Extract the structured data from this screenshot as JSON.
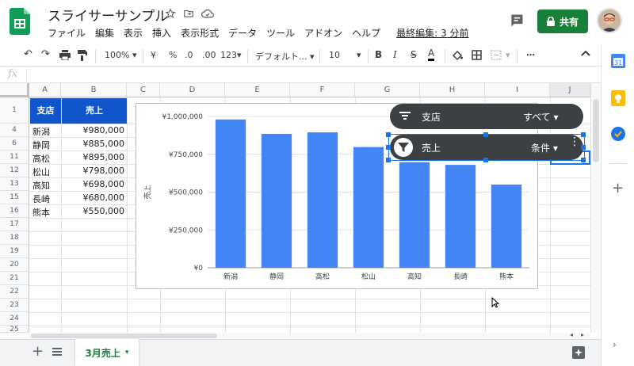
{
  "doc": {
    "title": "スライサーサンプル"
  },
  "menu": [
    "ファイル",
    "編集",
    "表示",
    "挿入",
    "表示形式",
    "データ",
    "ツール",
    "アドオン",
    "ヘルプ"
  ],
  "last_edit": "最終編集: 3 分前",
  "share_label": "共有",
  "toolbar": {
    "zoom": "100%",
    "currency": "¥",
    "percent": "%",
    "dec_less": ".0",
    "dec_more": ".00",
    "more_formats": "123",
    "font": "デフォルト...",
    "font_size": "10",
    "bold": "B",
    "italic": "I",
    "strike": "S",
    "text_color": "A"
  },
  "formula": {
    "fx": "fx"
  },
  "columns": [
    "A",
    "B",
    "C",
    "D",
    "E",
    "F",
    "G",
    "H",
    "I",
    "J"
  ],
  "rows": [
    "1",
    "4",
    "6",
    "11",
    "12",
    "13",
    "15",
    "16",
    "17",
    "18",
    "19",
    "20",
    "21",
    "22",
    "23",
    "24",
    "25"
  ],
  "table": {
    "headers": [
      "支店",
      "売上"
    ],
    "data": [
      [
        "新潟",
        "¥980,000"
      ],
      [
        "静岡",
        "¥885,000"
      ],
      [
        "高松",
        "¥895,000"
      ],
      [
        "松山",
        "¥798,000"
      ],
      [
        "高知",
        "¥698,000"
      ],
      [
        "長崎",
        "¥680,000"
      ],
      [
        "熊本",
        "¥550,000"
      ]
    ]
  },
  "chart_data": {
    "type": "bar",
    "categories": [
      "新潟",
      "静岡",
      "高松",
      "松山",
      "高知",
      "長崎",
      "熊本"
    ],
    "values": [
      980000,
      885000,
      895000,
      798000,
      698000,
      680000,
      550000
    ],
    "ylabel": "売上",
    "ylim": [
      0,
      1000000
    ],
    "yticks": [
      "¥0",
      "¥250,000",
      "¥500,000",
      "¥750,000",
      "¥1,000,000"
    ],
    "bar_color": "#4285f4",
    "grid": true
  },
  "slicers": [
    {
      "name": "支店",
      "value": "すべて"
    },
    {
      "name": "売上",
      "value": "条件"
    }
  ],
  "sheet_tab": "3月売上",
  "colors": {
    "accent": "#188038",
    "header_fill": "#1155cc",
    "slicer": "#3c4043"
  }
}
